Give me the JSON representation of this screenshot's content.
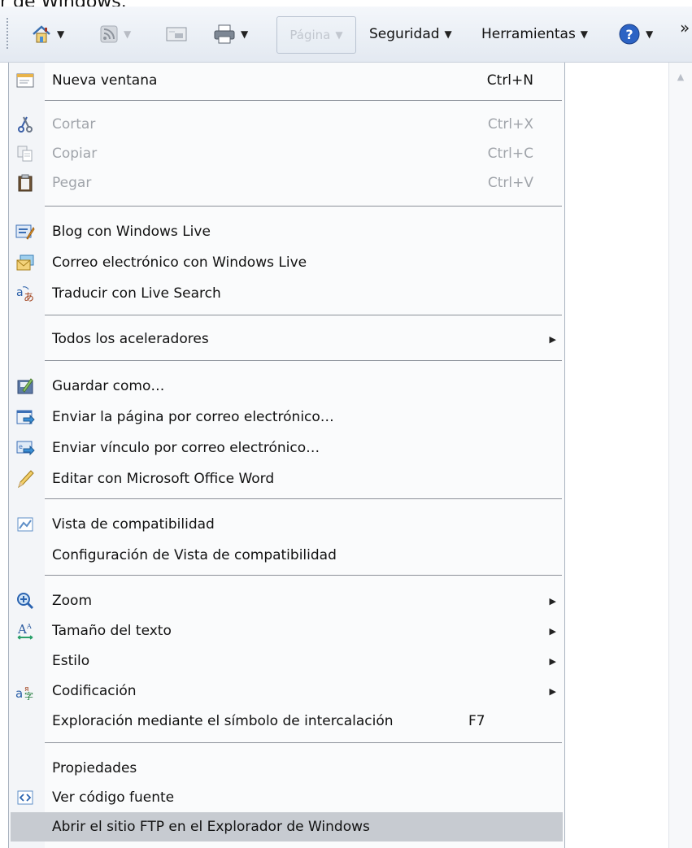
{
  "window_caption_fragment": "r de Windows.",
  "toolbar": {
    "pagina_label": "Página",
    "seguridad_label": "Seguridad",
    "herramientas_label": "Herramientas",
    "overflow_glyph": "»",
    "icons": [
      "home-icon",
      "rss-feeds-icon",
      "read-mail-icon",
      "print-icon",
      "help-icon"
    ]
  },
  "menu": {
    "items": [
      {
        "label": "Nueva ventana",
        "accel": "Ctrl+N",
        "icon": "new-window-icon"
      },
      {
        "label": "Cortar",
        "accel": "Ctrl+X",
        "icon": "scissors-icon",
        "disabled": true
      },
      {
        "label": "Copiar",
        "accel": "Ctrl+C",
        "icon": "copy-icon",
        "disabled": true
      },
      {
        "label": "Pegar",
        "accel": "Ctrl+V",
        "icon": "paste-icon",
        "disabled": true
      },
      {
        "label": "Blog con Windows Live",
        "icon": "blog-icon"
      },
      {
        "label": "Correo electrónico con Windows Live",
        "icon": "mail-live-icon"
      },
      {
        "label": "Traducir con Live Search",
        "icon": "translate-icon"
      },
      {
        "label": "Todos los aceleradores",
        "submenu": true
      },
      {
        "label": "Guardar como…",
        "icon": "save-icon"
      },
      {
        "label": "Enviar la página por correo electrónico…",
        "icon": "send-page-icon"
      },
      {
        "label": "Enviar vínculo por correo electrónico…",
        "icon": "send-link-icon"
      },
      {
        "label": "Editar con Microsoft Office Word",
        "icon": "pencil-icon"
      },
      {
        "label": "Vista de compatibilidad",
        "icon": "compat-view-icon"
      },
      {
        "label": "Configuración de Vista de compatibilidad"
      },
      {
        "label": "Zoom",
        "icon": "zoom-icon",
        "submenu": true
      },
      {
        "label": "Tamaño del texto",
        "icon": "text-size-icon",
        "submenu": true
      },
      {
        "label": "Estilo",
        "submenu": true
      },
      {
        "label": "Codificación",
        "icon": "encoding-icon",
        "submenu": true
      },
      {
        "label": "Exploración mediante el símbolo de intercalación",
        "accel": "F7"
      },
      {
        "label": "Propiedades"
      },
      {
        "label": "Ver código fuente",
        "icon": "view-source-icon"
      },
      {
        "label": "Abrir el sitio FTP en el Explorador de Windows",
        "highlighted": true
      }
    ]
  },
  "colors": {
    "menu_background": "#fafbfc",
    "gutter": "#f3f5f8",
    "highlight": "#c7cbd1",
    "separator": "#8b9099",
    "disabled_text": "#a0a4aa"
  }
}
